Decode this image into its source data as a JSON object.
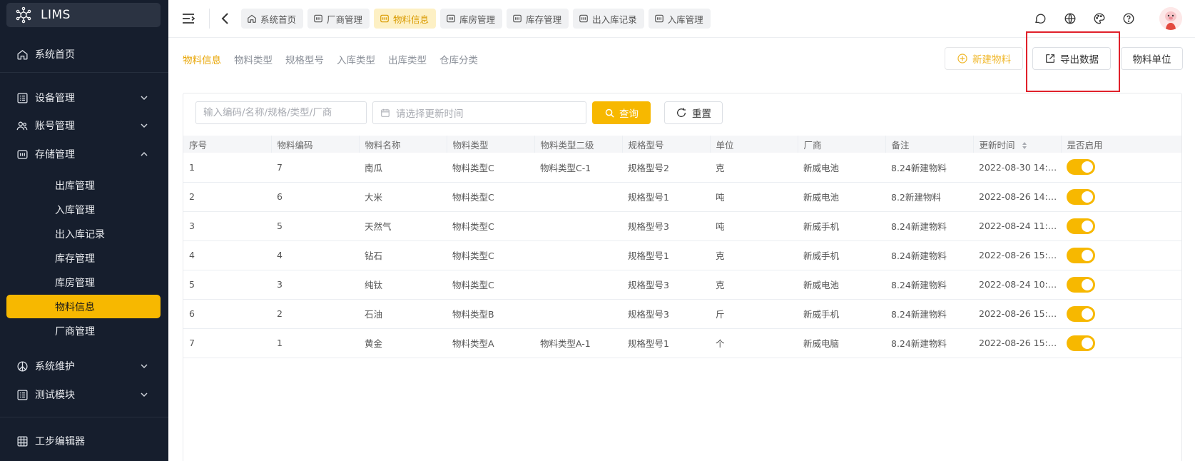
{
  "brand": {
    "name": "LIMS"
  },
  "sidebar": {
    "home": "系统首页",
    "groups": {
      "device": "设备管理",
      "account": "账号管理",
      "storage": "存储管理",
      "maintenance": "系统维护",
      "test": "测试模块",
      "process_editor": "工步编辑器"
    },
    "storage_items": [
      "出库管理",
      "入库管理",
      "出入库记录",
      "库存管理",
      "库房管理",
      "物料信息",
      "厂商管理"
    ],
    "active_item": "物料信息"
  },
  "topbar": {
    "tabs": [
      {
        "label": "系统首页",
        "icon": "home-icon",
        "active": false
      },
      {
        "label": "厂商管理",
        "icon": "table-icon",
        "active": false
      },
      {
        "label": "物料信息",
        "icon": "table-icon",
        "active": true
      },
      {
        "label": "库房管理",
        "icon": "table-icon",
        "active": false
      },
      {
        "label": "库存管理",
        "icon": "table-icon",
        "active": false
      },
      {
        "label": "出入库记录",
        "icon": "table-icon",
        "active": false
      },
      {
        "label": "入库管理",
        "icon": "table-icon",
        "active": false
      }
    ],
    "right_icons": [
      "message-icon",
      "globe-icon",
      "palette-icon",
      "help-icon",
      "avatar"
    ]
  },
  "subnav": {
    "items": [
      "物料信息",
      "物料类型",
      "规格型号",
      "入库类型",
      "出库类型",
      "仓库分类"
    ],
    "active": "物料信息"
  },
  "actions": {
    "new_material": "新建物料",
    "export_data": "导出数据",
    "material_unit": "物料单位"
  },
  "filters": {
    "search_placeholder": "输入编码/名称/规格/类型/厂商",
    "date_placeholder": "请选择更新时间",
    "query_label": "查询",
    "reset_label": "重置"
  },
  "table": {
    "columns": [
      "序号",
      "物料编码",
      "物料名称",
      "物料类型",
      "物料类型二级",
      "规格型号",
      "单位",
      "厂商",
      "备注",
      "更新时间",
      "是否启用"
    ],
    "rows": [
      [
        "1",
        "7",
        "南瓜",
        "物料类型C",
        "物料类型C-1",
        "规格型号2",
        "克",
        "新威电池",
        "8.24新建物料",
        "2022-08-30 14:0..."
      ],
      [
        "2",
        "6",
        "大米",
        "物料类型C",
        "",
        "规格型号1",
        "吨",
        "新威电池",
        "8.2新建物料",
        "2022-08-26 14:5..."
      ],
      [
        "3",
        "5",
        "天然气",
        "物料类型C",
        "",
        "规格型号3",
        "吨",
        "新威手机",
        "8.24新建物料",
        "2022-08-24 11:25..."
      ],
      [
        "4",
        "4",
        "钻石",
        "物料类型C",
        "",
        "规格型号1",
        "克",
        "新威手机",
        "8.24新建物料",
        "2022-08-26 15:5..."
      ],
      [
        "5",
        "3",
        "纯钛",
        "物料类型C",
        "",
        "规格型号3",
        "克",
        "新威电池",
        "8.24新建物料",
        "2022-08-24 10:0..."
      ],
      [
        "6",
        "2",
        "石油",
        "物料类型B",
        "",
        "规格型号3",
        "斤",
        "新威手机",
        "8.24新建物料",
        "2022-08-26 15:5..."
      ],
      [
        "7",
        "1",
        "黄金",
        "物料类型A",
        "物料类型A-1",
        "规格型号1",
        "个",
        "新威电脑",
        "8.24新建物料",
        "2022-08-26 15:3..."
      ]
    ],
    "enabled": [
      true,
      true,
      true,
      true,
      true,
      true,
      true
    ]
  },
  "colors": {
    "accent": "#f7b800",
    "sidebar_bg": "#161e2d",
    "highlight_border": "#e0212b"
  }
}
